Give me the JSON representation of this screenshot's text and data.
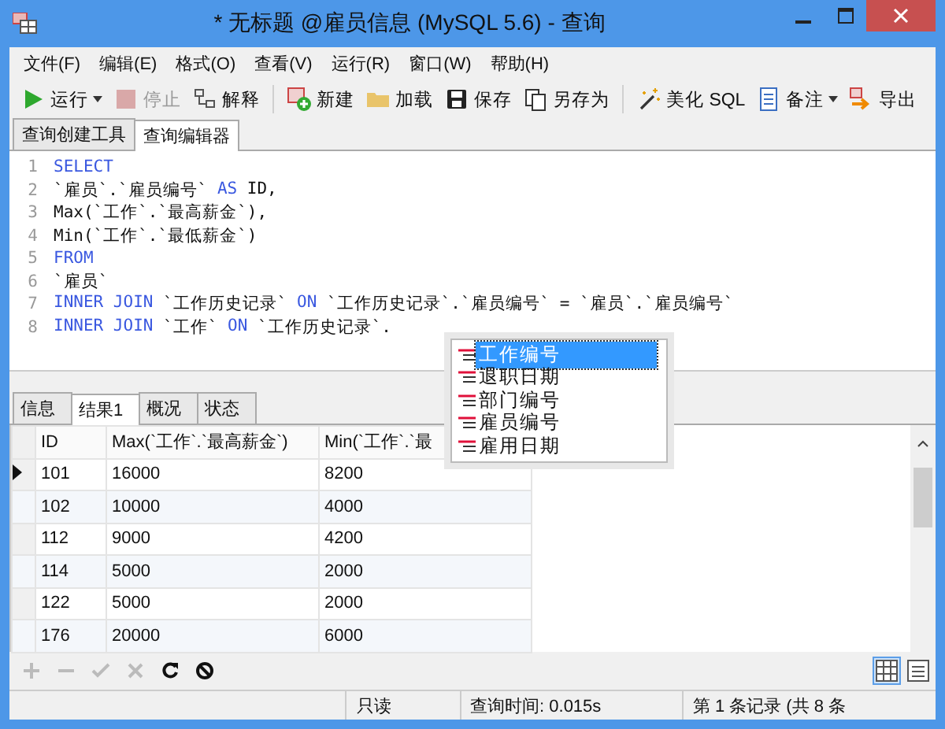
{
  "window": {
    "title": "* 无标题 @雇员信息 (MySQL 5.6) - 查询"
  },
  "menu": [
    "文件(F)",
    "编辑(E)",
    "格式(O)",
    "查看(V)",
    "运行(R)",
    "窗口(W)",
    "帮助(H)"
  ],
  "toolbar": [
    {
      "label": "运行",
      "kind": "run",
      "dropdown": true,
      "disabled": false
    },
    {
      "label": "停止",
      "kind": "stop",
      "dropdown": false,
      "disabled": true
    },
    {
      "label": "解释",
      "kind": "explain",
      "dropdown": false,
      "disabled": false
    },
    {
      "label": "新建",
      "kind": "new",
      "dropdown": false,
      "disabled": false
    },
    {
      "label": "加载",
      "kind": "folder",
      "dropdown": false,
      "disabled": false
    },
    {
      "label": "保存",
      "kind": "save",
      "dropdown": false,
      "disabled": false
    },
    {
      "label": "另存为",
      "kind": "saveas",
      "dropdown": false,
      "disabled": false
    },
    {
      "label": "美化 SQL",
      "kind": "wand",
      "dropdown": false,
      "disabled": false
    },
    {
      "label": "备注",
      "kind": "note",
      "dropdown": true,
      "disabled": false
    },
    {
      "label": "导出",
      "kind": "export",
      "dropdown": false,
      "disabled": false
    }
  ],
  "editor_tabs": [
    {
      "label": "查询创建工具",
      "selected": false
    },
    {
      "label": "查询编辑器",
      "selected": true
    }
  ],
  "editor": {
    "lines": [
      {
        "number": "1",
        "tokens": [
          {
            "text": "SELECT",
            "kind": "keyword"
          }
        ]
      },
      {
        "number": "2",
        "tokens": [
          {
            "text": "`雇员`.`雇员编号` ",
            "kind": "text"
          },
          {
            "text": "AS",
            "kind": "keyword"
          },
          {
            "text": " ID,",
            "kind": "text"
          }
        ]
      },
      {
        "number": "3",
        "tokens": [
          {
            "text": "Max(`工作`.`最高薪金`),",
            "kind": "text"
          }
        ]
      },
      {
        "number": "4",
        "tokens": [
          {
            "text": "Min(`工作`.`最低薪金`)",
            "kind": "text"
          }
        ]
      },
      {
        "number": "5",
        "tokens": [
          {
            "text": "FROM",
            "kind": "keyword"
          }
        ]
      },
      {
        "number": "6",
        "tokens": [
          {
            "text": "`雇员`",
            "kind": "text"
          }
        ]
      },
      {
        "number": "7",
        "tokens": [
          {
            "text": "INNER JOIN",
            "kind": "keyword"
          },
          {
            "text": " `工作历史记录` ",
            "kind": "text"
          },
          {
            "text": "ON",
            "kind": "keyword"
          },
          {
            "text": " `工作历史记录`.`雇员编号` = `雇员`.`雇员编号`",
            "kind": "text"
          }
        ]
      },
      {
        "number": "8",
        "tokens": [
          {
            "text": "INNER JOIN",
            "kind": "keyword"
          },
          {
            "text": " `工作` ",
            "kind": "text"
          },
          {
            "text": "ON",
            "kind": "keyword"
          },
          {
            "text": " `工作历史记录`.",
            "kind": "text"
          }
        ]
      }
    ]
  },
  "autocomplete": [
    {
      "label": "工作编号",
      "selected": true
    },
    {
      "label": "退职日期",
      "selected": false
    },
    {
      "label": "部门编号",
      "selected": false
    },
    {
      "label": "雇员编号",
      "selected": false
    },
    {
      "label": "雇用日期",
      "selected": false
    }
  ],
  "result_tabs": [
    {
      "label": "信息",
      "selected": false
    },
    {
      "label": "结果1",
      "selected": true
    },
    {
      "label": "概况",
      "selected": false
    },
    {
      "label": "状态",
      "selected": false
    }
  ],
  "table": {
    "columns": [
      "ID",
      "Max(`工作`.`最高薪金`)",
      "Min(`工作`.`最"
    ],
    "rows": [
      {
        "cells": [
          "101",
          "16000",
          "8200"
        ],
        "current": true
      },
      {
        "cells": [
          "102",
          "10000",
          "4000"
        ],
        "current": false
      },
      {
        "cells": [
          "112",
          "9000",
          "4200"
        ],
        "current": false
      },
      {
        "cells": [
          "114",
          "5000",
          "2000"
        ],
        "current": false
      },
      {
        "cells": [
          "122",
          "5000",
          "2000"
        ],
        "current": false
      },
      {
        "cells": [
          "176",
          "20000",
          "6000"
        ],
        "current": false
      }
    ]
  },
  "grid_tools": [
    {
      "kind": "plus",
      "disabled": true
    },
    {
      "kind": "minus",
      "disabled": true
    },
    {
      "kind": "check",
      "disabled": true
    },
    {
      "kind": "cross",
      "disabled": true
    },
    {
      "kind": "refresh",
      "disabled": false
    },
    {
      "kind": "stop",
      "disabled": false
    }
  ],
  "view_modes": [
    {
      "kind": "grid",
      "selected": true
    },
    {
      "kind": "form",
      "selected": false
    }
  ],
  "status_bar": [
    "只读",
    "查询时间: 0.015s",
    "第 1 条记录 (共 8 条"
  ]
}
